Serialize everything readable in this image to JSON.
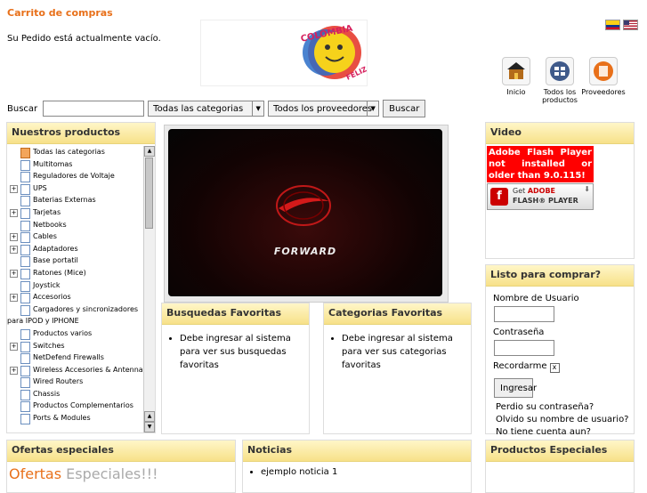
{
  "cart": {
    "title": "Carrito de compras",
    "status": "Su Pedido está actualmente vacío."
  },
  "logo": {
    "text_top": "COLOMBIA",
    "text_bottom": "FELIZ"
  },
  "header_icons": [
    {
      "label": "Inicio",
      "icon": "home-icon"
    },
    {
      "label": "Todos los productos",
      "icon": "products-icon"
    },
    {
      "label": "Proveedores",
      "icon": "providers-icon"
    }
  ],
  "search": {
    "label": "Buscar",
    "value": "",
    "category_select": "Todas las categorias",
    "provider_select": "Todos los proveedores",
    "button": "Buscar"
  },
  "products_panel": {
    "title": "Nuestros productos",
    "items": [
      {
        "label": "Todas las categorias",
        "expandable": false,
        "root": true
      },
      {
        "label": "Multitomas",
        "expandable": false
      },
      {
        "label": "Reguladores de Voltaje",
        "expandable": false
      },
      {
        "label": "UPS",
        "expandable": true
      },
      {
        "label": "Baterias Externas",
        "expandable": false
      },
      {
        "label": "Tarjetas",
        "expandable": true
      },
      {
        "label": "Netbooks",
        "expandable": false
      },
      {
        "label": "Cables",
        "expandable": true
      },
      {
        "label": "Adaptadores",
        "expandable": true
      },
      {
        "label": "Base portatil",
        "expandable": false
      },
      {
        "label": "Ratones (Mice)",
        "expandable": true
      },
      {
        "label": "Joystick",
        "expandable": false
      },
      {
        "label": "Accesorios",
        "expandable": true
      },
      {
        "label": "Cargadores y sincronizadores",
        "expandable": false
      },
      {
        "label": "para IPOD y IPHONE",
        "expandable": false,
        "wrap": true
      },
      {
        "label": "Productos varios",
        "expandable": false
      },
      {
        "label": "Switches",
        "expandable": true
      },
      {
        "label": "NetDefend Firewalls",
        "expandable": false
      },
      {
        "label": "Wireless Accesories & Antennas",
        "expandable": true
      },
      {
        "label": "Wired Routers",
        "expandable": false
      },
      {
        "label": "Chassis",
        "expandable": false
      },
      {
        "label": "Productos Complementarios",
        "expandable": false
      },
      {
        "label": "Ports & Modules",
        "expandable": false
      }
    ]
  },
  "banner": {
    "brand": "FORWARD"
  },
  "fav_searches": {
    "title": "Busquedas Favoritas",
    "message": "Debe ingresar al sistema para ver sus busquedas favoritas"
  },
  "fav_categories": {
    "title": "Categorias Favoritas",
    "message": "Debe ingresar al sistema para ver sus categorias favoritas"
  },
  "video": {
    "title": "Video",
    "warning": "Adobe Flash Player not installed or older than 9.0.115!",
    "get_line_1_prefix": "Get ",
    "get_line_1_brand": "ADOBE",
    "get_line_2": "FLASH® PLAYER"
  },
  "login": {
    "title": "Listo para comprar?",
    "username_label": "Nombre de Usuario",
    "password_label": "Contraseña",
    "remember_label": "Recordarme",
    "remember_checked": "x",
    "submit": "Ingresar",
    "forgot_password": "Perdio su contraseña?",
    "forgot_username": "Olvido su nombre de usuario?",
    "register": "No tiene cuenta aun? Registrese"
  },
  "specials": {
    "title": "Ofertas especiales",
    "word_a": "Ofertas",
    "word_b": " Especiales!!!"
  },
  "news": {
    "title": "Noticias",
    "items": [
      "ejemplo noticia 1"
    ]
  },
  "special_products": {
    "title": "Productos Especiales"
  }
}
